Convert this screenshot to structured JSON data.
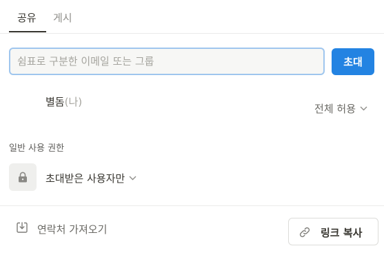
{
  "tabs": [
    {
      "label": "공유",
      "active": true
    },
    {
      "label": "게시",
      "active": false
    }
  ],
  "invite": {
    "placeholder": "쉼표로 구분한 이메일 또는 그룹",
    "value": "",
    "button_label": "초대"
  },
  "member": {
    "name": "별돔",
    "you_label": "(나)",
    "permission": "전체 허용",
    "icon": "chevron-down-icon"
  },
  "general_access": {
    "section_label": "일반 사용 권한",
    "lock_icon": "lock-icon",
    "value": "초대받은 사용자만",
    "icon": "chevron-down-icon"
  },
  "footer": {
    "import_label": "연락처 가져오기",
    "import_icon": "import-icon",
    "copy_link_label": "링크 복사",
    "copy_link_icon": "link-icon"
  },
  "colors": {
    "accent": "#2383e2",
    "input_focus_border": "#9fc6ee",
    "input_background": "#f7f7f5",
    "text_primary": "#37352f",
    "text_secondary": "#6b6a65"
  }
}
